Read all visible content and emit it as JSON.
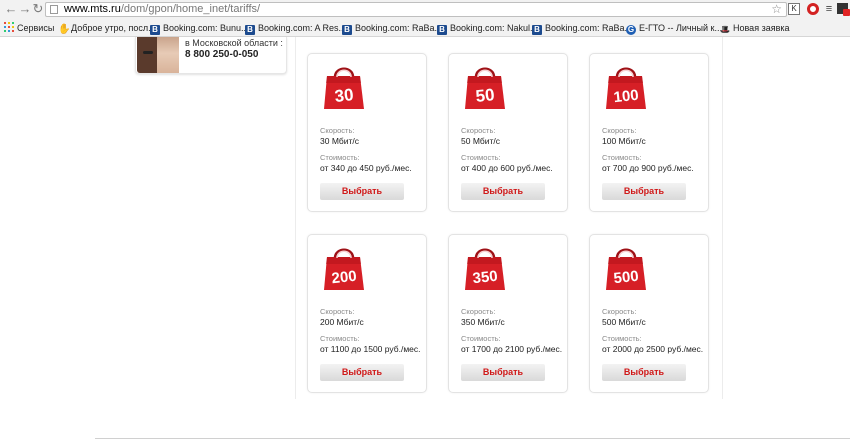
{
  "browser": {
    "url_host": "www.mts.ru",
    "url_path": "/dom/gpon/home_inet/tariffs/",
    "ext_k": "K",
    "bookmarks": [
      {
        "label": "Сервисы",
        "icon": "apps-icon"
      },
      {
        "label": "Доброе утро, посл...",
        "icon": "hand-icon"
      },
      {
        "label": "Booking.com: Bunu...",
        "icon": "booking-icon",
        "badge": "B"
      },
      {
        "label": "Booking.com: A Res...",
        "icon": "booking-icon",
        "badge": "B"
      },
      {
        "label": "Booking.com: RaBa...",
        "icon": "booking-icon",
        "badge": "B"
      },
      {
        "label": "Booking.com: Nakul...",
        "icon": "booking-icon",
        "badge": "B"
      },
      {
        "label": "Booking.com: RaBa...",
        "icon": "booking-icon",
        "badge": "B"
      },
      {
        "label": "Е-ГТО -- Личный к...",
        "icon": "gto-icon",
        "badge": "G"
      },
      {
        "label": "Новая заявка",
        "icon": "hat-icon"
      }
    ]
  },
  "contact": {
    "region": "в Московской области :",
    "phone": "8 800 250-0-050"
  },
  "tariffs": [
    {
      "bag_number": "30",
      "speed_label": "Скорость:",
      "speed": "30 Мбит/с",
      "price_label": "Стоимость:",
      "price": "от 340 до 450 руб./мес.",
      "button": "Выбрать"
    },
    {
      "bag_number": "50",
      "speed_label": "Скорость:",
      "speed": "50 Мбит/с",
      "price_label": "Стоимость:",
      "price": "от 400 до 600 руб./мес.",
      "button": "Выбрать"
    },
    {
      "bag_number": "100",
      "speed_label": "Скорость:",
      "speed": "100 Мбит/с",
      "price_label": "Стоимость:",
      "price": "от 700 до 900 руб./мес.",
      "button": "Выбрать"
    },
    {
      "bag_number": "200",
      "speed_label": "Скорость:",
      "speed": "200 Мбит/с",
      "price_label": "Стоимость:",
      "price": "от 1100 до 1500 руб./мес.",
      "button": "Выбрать"
    },
    {
      "bag_number": "350",
      "speed_label": "Скорость:",
      "speed": "350 Мбит/с",
      "price_label": "Стоимость:",
      "price": "от 1700 до 2100 руб./мес.",
      "button": "Выбрать"
    },
    {
      "bag_number": "500",
      "speed_label": "Скорость:",
      "speed": "500 Мбит/с",
      "price_label": "Стоимость:",
      "price": "от 2000 до 2500 руб./мес.",
      "button": "Выбрать"
    }
  ],
  "colors": {
    "brand_red": "#d61f26",
    "button_text": "#d01818"
  }
}
